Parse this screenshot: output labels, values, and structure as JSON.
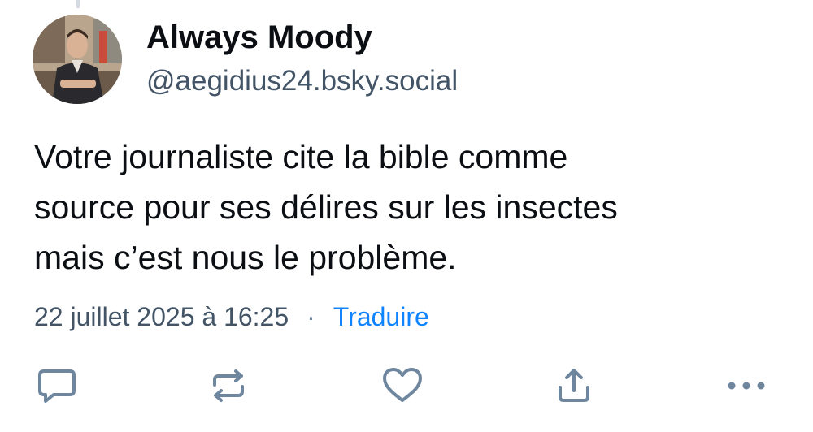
{
  "author": {
    "display_name": "Always Moody",
    "handle": "@aegidius24.bsky.social",
    "avatar_icon": "avatar-photo"
  },
  "post": {
    "text_lines": [
      "Votre journaliste cite la bible comme",
      "source pour ses délires sur les insectes",
      "mais c’est nous le problème."
    ],
    "timestamp": "22 juillet 2025 à 16:25",
    "separator": "·",
    "translate_label": "Traduire"
  },
  "actions": [
    {
      "name": "reply",
      "icon": "speech-bubble-icon"
    },
    {
      "name": "repost",
      "icon": "repost-arrows-icon"
    },
    {
      "name": "like",
      "icon": "heart-icon"
    },
    {
      "name": "share",
      "icon": "share-upload-icon"
    },
    {
      "name": "more",
      "icon": "ellipsis-icon"
    }
  ],
  "colors": {
    "text_primary": "#0b0f14",
    "text_secondary": "#425466",
    "link": "#1083fe",
    "icon": "#6f869f"
  }
}
